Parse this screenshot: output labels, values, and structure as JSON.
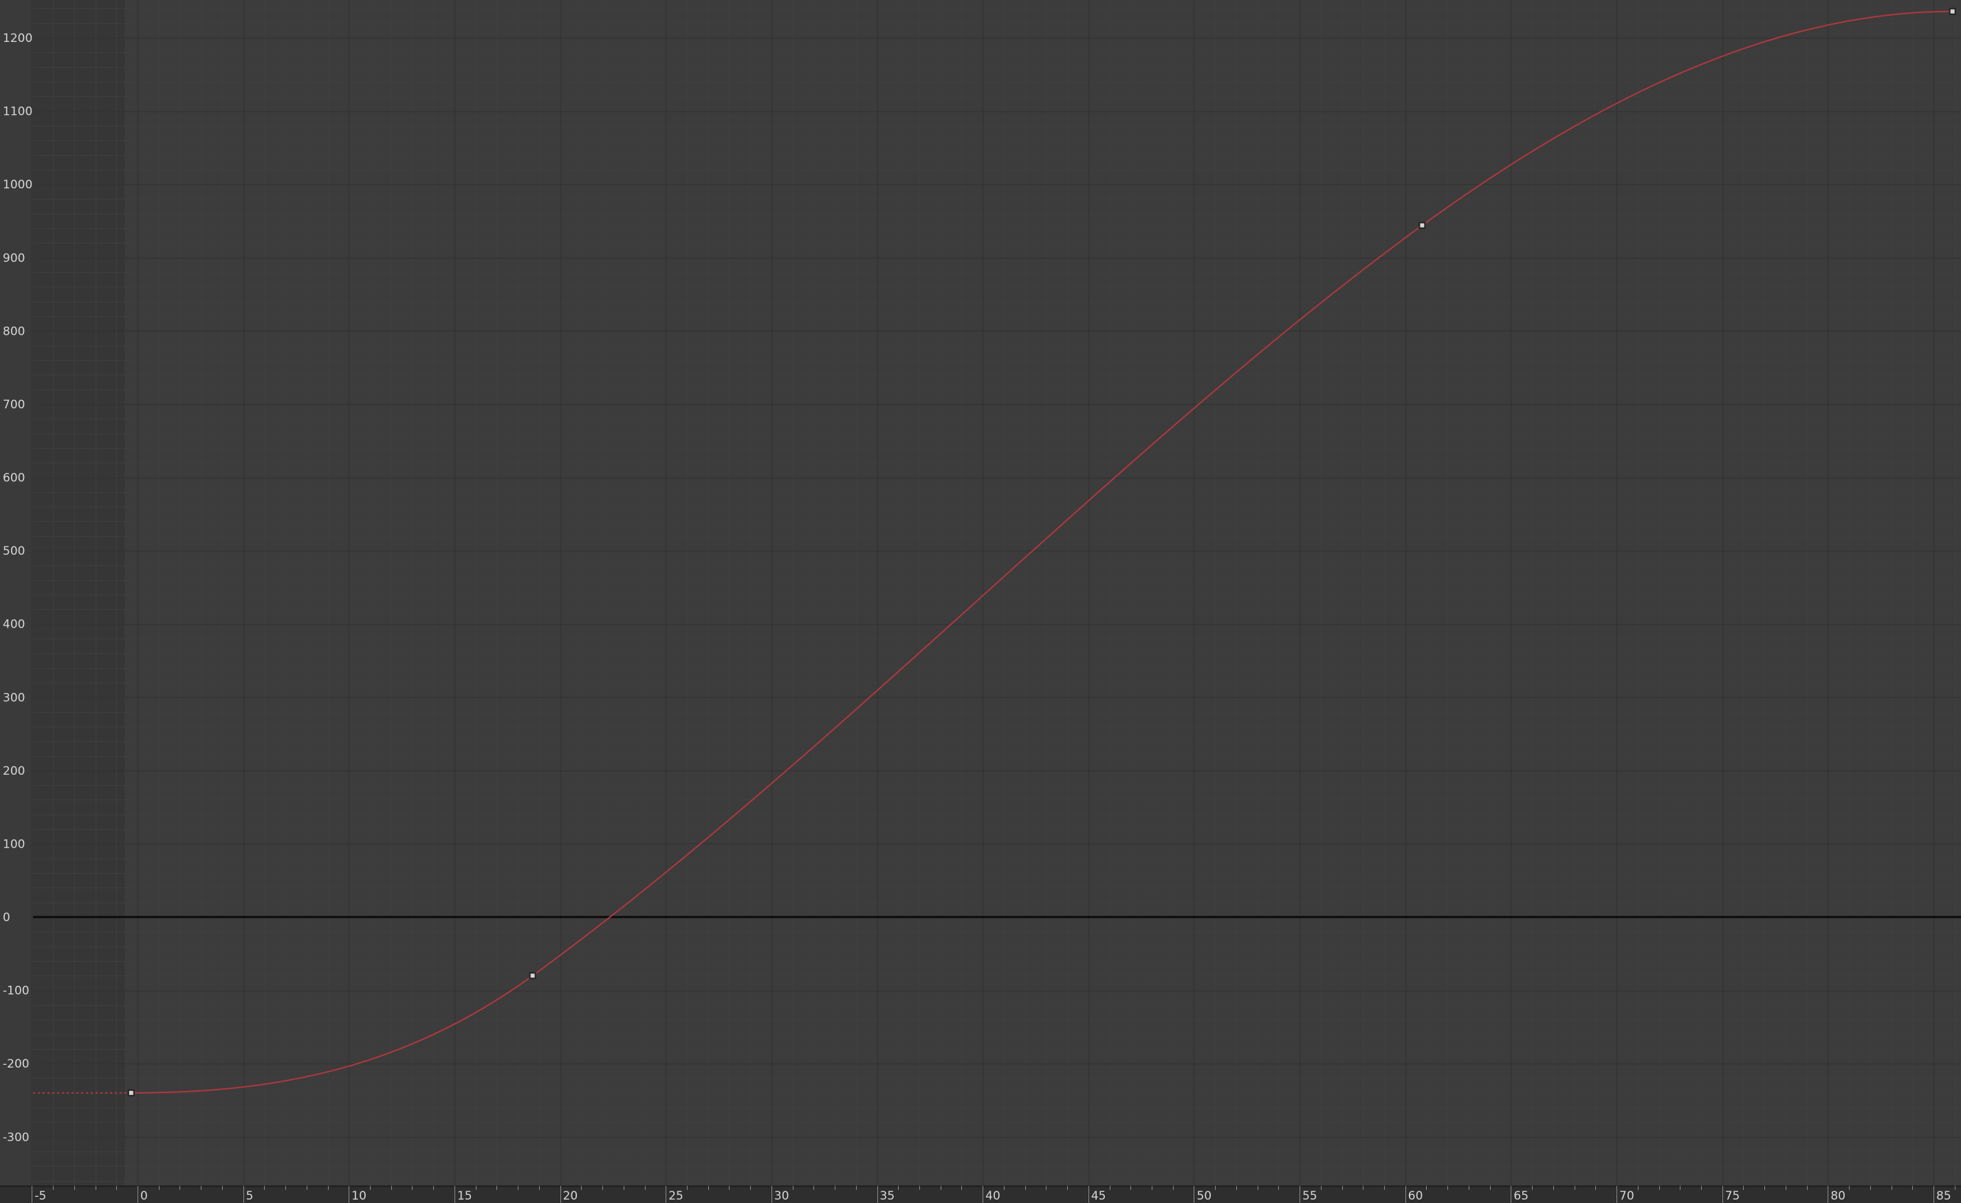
{
  "editor": {
    "name": "graph-editor",
    "colors": {
      "background": "#3c3c3c",
      "out_of_range": "#363636",
      "grid_major": "#333333",
      "grid_minor": "#3f3f3f",
      "zero_line": "#0a0a0a",
      "curve": "#b0383e",
      "key_fill": "#d4d4d4",
      "key_stroke": "#222222",
      "ruler_bg": "#2e2e2e",
      "label": "#d6d6d6"
    }
  },
  "chart_data": {
    "type": "line",
    "title": "",
    "xlabel": "",
    "ylabel": "",
    "xlim": [
      -5,
      86.5
    ],
    "ylim": [
      -370,
      1255
    ],
    "grid": true,
    "x_ticks": [
      -5,
      0,
      5,
      10,
      15,
      20,
      25,
      30,
      35,
      40,
      45,
      50,
      55,
      60,
      65,
      70,
      75,
      80,
      85
    ],
    "y_ticks": [
      1200,
      1100,
      1000,
      900,
      800,
      700,
      600,
      500,
      400,
      300,
      200,
      100,
      0,
      -100,
      -200,
      -300
    ],
    "x_tick_labels": [
      "-5",
      "0",
      "5",
      "10",
      "15",
      "20",
      "25",
      "30",
      "35",
      "40",
      "45",
      "50",
      "55",
      "60",
      "65",
      "70",
      "75",
      "80",
      "85"
    ],
    "y_tick_labels": [
      "1200",
      "1100",
      "1000",
      "900",
      "800",
      "700",
      "600",
      "500",
      "400",
      "300",
      "200",
      "100",
      "0",
      "-100",
      "-200",
      "-300"
    ],
    "frame_range_start": -0.6,
    "pre_infinity_extrapolation": "constant",
    "series": [
      {
        "color": "#b0383e",
        "keyframes": [
          {
            "x": -0.3,
            "y": -240
          },
          {
            "x": 18.7,
            "y": -80
          },
          {
            "x": 60.8,
            "y": 944
          },
          {
            "x": 85.9,
            "y": 1236
          }
        ],
        "tangents": [
          {
            "in": 0,
            "out": 0
          },
          {
            "in": 21,
            "out": 21
          },
          {
            "in": 21,
            "out": 21
          },
          {
            "in": 0,
            "out": 0
          }
        ]
      }
    ]
  }
}
